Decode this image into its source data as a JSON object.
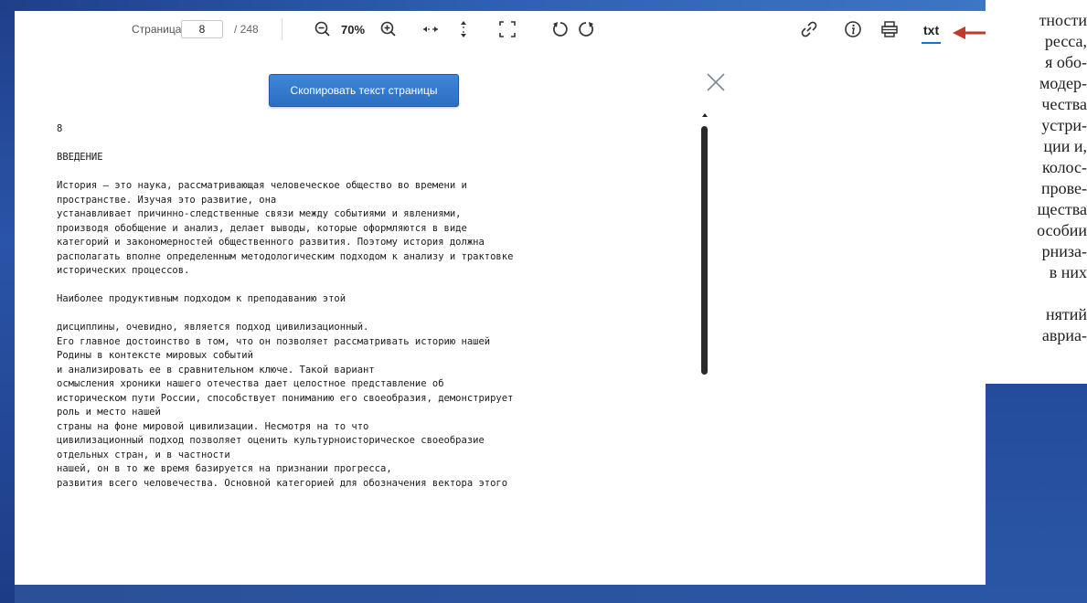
{
  "toolbar": {
    "page_label": "Страница",
    "page_value": "8",
    "page_total": "/ 248",
    "zoom_level": "70%",
    "txt_label": "txt",
    "icons": [
      "zoom-out-icon",
      "zoom-in-icon",
      "fit-width-icon",
      "fit-height-icon",
      "fullscreen-icon",
      "rotate-left-icon",
      "rotate-right-icon",
      "link-icon",
      "info-icon",
      "print-icon"
    ],
    "accent_color": "#1b6fd1",
    "arrow_color": "#c0392b"
  },
  "copy_button_label": "Скопировать текст страницы",
  "document_lines": [
    "8",
    "",
    "ВВЕДЕНИЕ",
    "",
    "История – это наука, рассматривающая человеческое общество во времени и",
    "пространстве. Изучая это развитие, она",
    "устанавливает причинно-следственные связи между событиями и явлениями,",
    "производя обобщение и анализ, делает выводы, которые оформляются в виде",
    "категорий и закономерностей общественного развития. Поэтому история должна",
    "располагать вполне определенным методологическим подходом к анализу и трактовке",
    "исторических процессов.",
    "",
    "Наиболее продуктивным подходом к преподаванию этой",
    "",
    "дисциплины, очевидно, является подход цивилизационный.",
    "Его главное достоинство в том, что он позволяет рассматривать историю нашей",
    "Родины в контексте мировых событий",
    "и анализировать ее в сравнительном ключе. Такой вариант",
    "осмысления хроники нашего отечества дает целостное представление об",
    "историческом пути России, способствует пониманию его своеобразия, демонстрирует",
    "роль и место нашей",
    "страны на фоне мировой цивилизации. Несмотря на то что",
    "цивилизационный подход позволяет оценить культурноисторическое своеобразие",
    "отдельных стран, и в частности",
    "нашей, он в то же время базируется на признании прогресса,",
    "развития всего человечества. Основной категорией для обозначения вектора этого"
  ],
  "book_lines": [
    "тности",
    "ресса,",
    "я обо-",
    "модер-",
    "чества",
    "устри-",
    "ции и,",
    "колос-",
    "прове-",
    "щества",
    "особии",
    "рниза-",
    "в них",
    "",
    "нятий",
    "авриа-"
  ]
}
